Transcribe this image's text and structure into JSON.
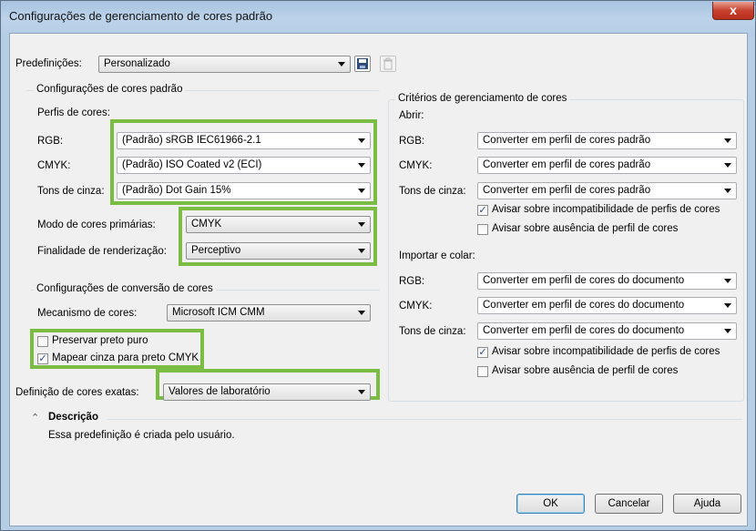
{
  "window": {
    "title": "Configurações de gerenciamento de cores padrão",
    "close_glyph": "x"
  },
  "presets": {
    "label": "Predefinições:",
    "value": "Personalizado"
  },
  "default_colors": {
    "group_title": "Configurações de cores padrão",
    "profiles_label": "Perfis de cores:",
    "rgb_label": "RGB:",
    "rgb_value": "(Padrão) sRGB IEC61966-2.1",
    "cmyk_label": "CMYK:",
    "cmyk_value": "(Padrão) ISO Coated v2 (ECI)",
    "gray_label": "Tons de cinza:",
    "gray_value": "(Padrão) Dot Gain 15%",
    "primary_mode_label": "Modo de cores primárias:",
    "primary_mode_value": "CMYK",
    "rendering_label": "Finalidade de renderização:",
    "rendering_value": "Perceptivo"
  },
  "conversion": {
    "group_title": "Configurações de conversão de cores",
    "engine_label": "Mecanismo de cores:",
    "engine_value": "Microsoft ICM CMM",
    "preserve_black_label": "Preservar preto puro",
    "preserve_black_checked": false,
    "map_gray_label": "Mapear cinza para preto CMYK",
    "map_gray_checked": true
  },
  "spot": {
    "label": "Definição de cores exatas:",
    "value": "Valores de laboratório"
  },
  "policies": {
    "group_title": "Critérios de gerenciamento de cores",
    "open_label": "Abrir:",
    "open_rgb_label": "RGB:",
    "open_rgb_value": "Converter em perfil de cores padrão",
    "open_cmyk_label": "CMYK:",
    "open_cmyk_value": "Converter em perfil de cores padrão",
    "open_gray_label": "Tons de cinza:",
    "open_gray_value": "Converter em perfil de cores padrão",
    "open_warn_mismatch_label": "Avisar sobre incompatibilidade de perfis de cores",
    "open_warn_mismatch_checked": true,
    "open_warn_missing_label": "Avisar sobre ausência de perfil de cores",
    "open_warn_missing_checked": false,
    "import_label": "Importar e colar:",
    "import_rgb_label": "RGB:",
    "import_rgb_value": "Converter em perfil de cores do documento",
    "import_cmyk_label": "CMYK:",
    "import_cmyk_value": "Converter em perfil de cores do documento",
    "import_gray_label": "Tons de cinza:",
    "import_gray_value": "Converter em perfil de cores do documento",
    "import_warn_mismatch_label": "Avisar sobre incompatibilidade de perfis de cores",
    "import_warn_mismatch_checked": true,
    "import_warn_missing_label": "Avisar sobre ausência de perfil de cores",
    "import_warn_missing_checked": false
  },
  "description": {
    "title": "Descrição",
    "toggle_glyph": "⌃",
    "text": "Essa predefinição é criada pelo usuário."
  },
  "buttons": {
    "ok": "OK",
    "cancel": "Cancelar",
    "help": "Ajuda"
  },
  "colors": {
    "highlight": "#7bbd42",
    "title_bar": "#bcd3ea",
    "close": "#c7412e"
  }
}
